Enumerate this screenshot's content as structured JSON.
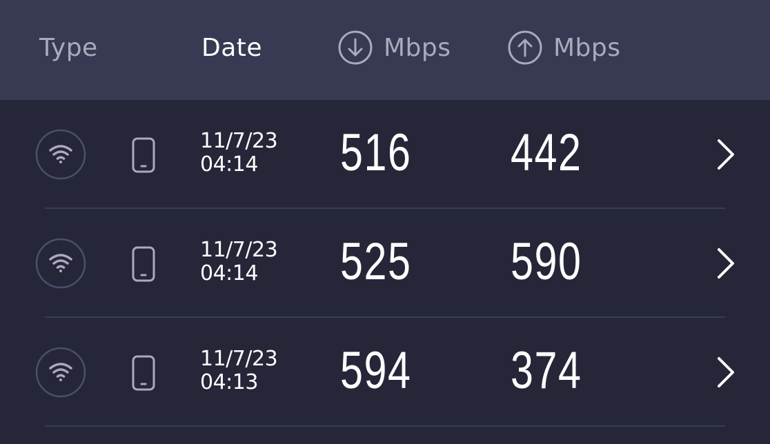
{
  "header": {
    "type_label": "Type",
    "date_label": "Date",
    "download_label": "Mbps",
    "upload_label": "Mbps",
    "download_icon": "arrow-down-circle-icon",
    "upload_icon": "arrow-up-circle-icon"
  },
  "results": [
    {
      "connection_icon": "wifi-icon",
      "device_icon": "phone-icon",
      "date": "11/7/23",
      "time": "04:14",
      "download": "516",
      "upload": "442"
    },
    {
      "connection_icon": "wifi-icon",
      "device_icon": "phone-icon",
      "date": "11/7/23",
      "time": "04:14",
      "download": "525",
      "upload": "590"
    },
    {
      "connection_icon": "wifi-icon",
      "device_icon": "phone-icon",
      "date": "11/7/23",
      "time": "04:13",
      "download": "594",
      "upload": "374"
    }
  ],
  "colors": {
    "background": "#262639",
    "header_background": "#373a52",
    "muted_text": "#a9abbd",
    "primary_text": "#ffffff",
    "divider": "#3a3c54"
  }
}
